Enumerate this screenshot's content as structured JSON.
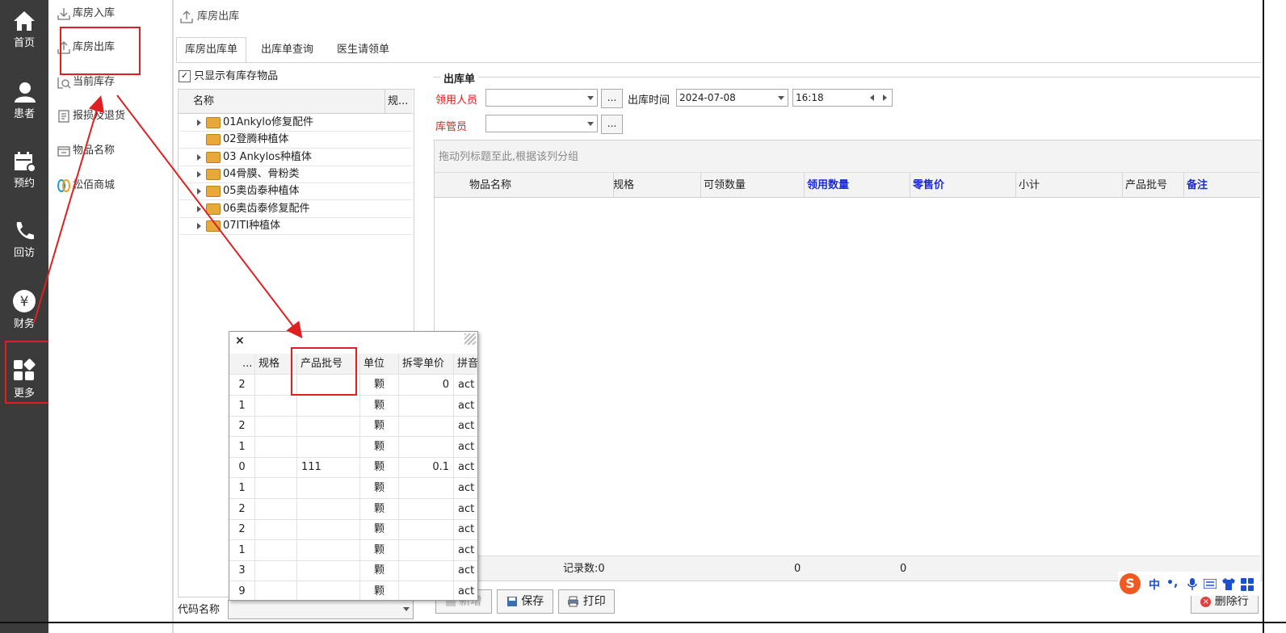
{
  "nav": {
    "home": "首页",
    "patient": "患者",
    "appointment": "预约",
    "followup": "回访",
    "finance": "财务",
    "more": "更多"
  },
  "submenu": {
    "items": [
      "库房入库",
      "库房出库",
      "当前库存",
      "报损及退货",
      "物品名称",
      "松佰商城"
    ]
  },
  "page_title": "库房出库",
  "tabs": [
    "库房出库单",
    "出库单查询",
    "医生请领单"
  ],
  "left": {
    "checkbox_label": "只显示有库存物品",
    "col_name": "名称",
    "col_spec": "规...",
    "tree": [
      "01Ankylo修复配件",
      "02登腾种植体",
      "03 Ankylos种植体",
      "04骨膜、骨粉类",
      "05奥齿泰种植体",
      "06奥齿泰修复配件",
      "07ITI种植体"
    ],
    "code_label": "代码名称"
  },
  "form": {
    "group_title": "出库单",
    "receiver_label": "领用人员",
    "time_label": "出库时间",
    "date_value": "2024-07-08",
    "time_value": "16:18",
    "keeper_label": "库管员",
    "dots": "..."
  },
  "grid": {
    "group_hint": "拖动列标题至此,根据该列分组",
    "columns": [
      "物品名称",
      "规格",
      "可领数量",
      "领用数量",
      "零售价",
      "小计",
      "产品批号",
      "备注"
    ],
    "footer_count": "记录数:0",
    "footer_sum1": "0",
    "footer_sum2": "0"
  },
  "popup": {
    "close": "×",
    "columns": [
      "...",
      "规格",
      "产品批号",
      "单位",
      "拆零单价",
      "拼音"
    ],
    "rows": [
      [
        "2",
        "",
        "",
        "颗",
        "0",
        "act"
      ],
      [
        "1",
        "",
        "",
        "颗",
        "",
        "act"
      ],
      [
        "2",
        "",
        "",
        "颗",
        "",
        "act"
      ],
      [
        "1",
        "",
        "",
        "颗",
        "",
        "act"
      ],
      [
        "0",
        "",
        "111",
        "颗",
        "0.1",
        "act"
      ],
      [
        "1",
        "",
        "",
        "颗",
        "",
        "act"
      ],
      [
        "2",
        "",
        "",
        "颗",
        "",
        "act"
      ],
      [
        "2",
        "",
        "",
        "颗",
        "",
        "act"
      ],
      [
        "1",
        "",
        "",
        "颗",
        "",
        "act"
      ],
      [
        "3",
        "",
        "",
        "颗",
        "",
        "act"
      ],
      [
        "9",
        "",
        "",
        "颗",
        "",
        "act"
      ]
    ]
  },
  "buttons": {
    "add": "新增",
    "save": "保存",
    "print": "打印",
    "delete_row": "删除行"
  },
  "ime": {
    "lang": "中",
    "punct": "•,"
  },
  "colors": {
    "nav_bg": "#3b3b3b",
    "red_label": "#e02020",
    "blue_header": "#1c2bd6"
  }
}
